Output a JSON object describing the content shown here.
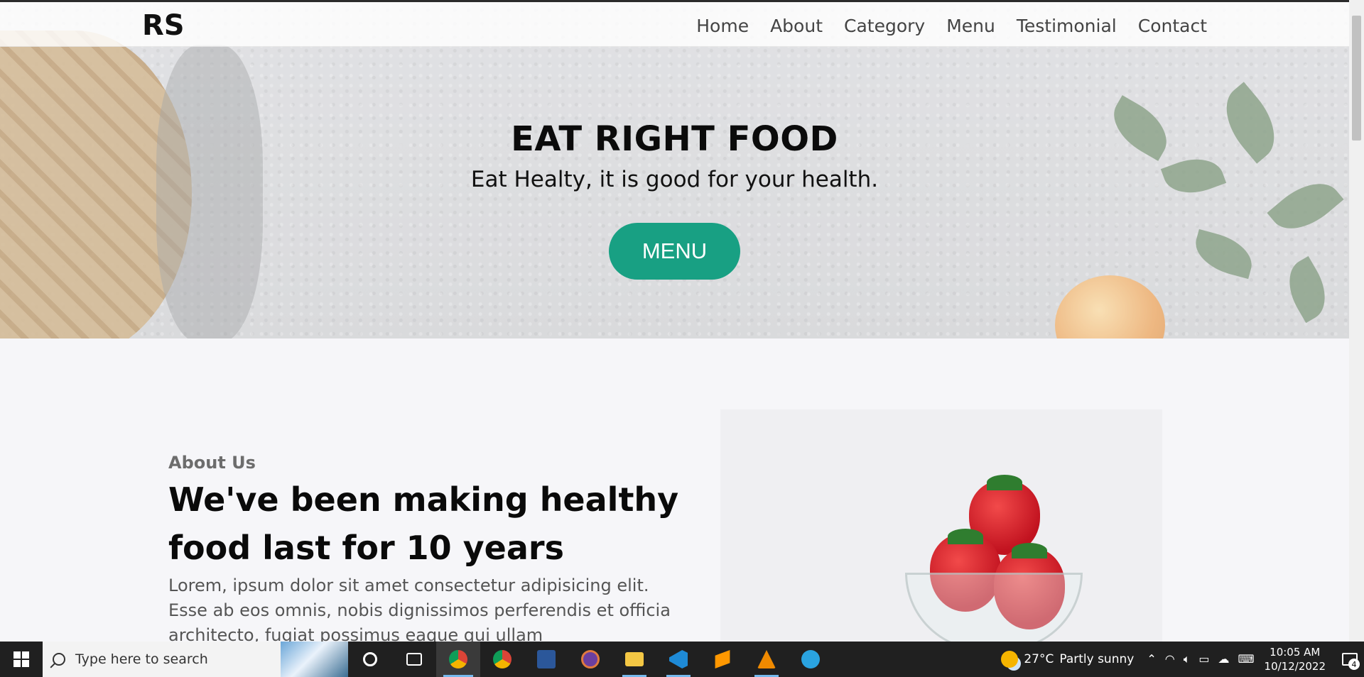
{
  "nav": {
    "logo": "RS",
    "items": [
      "Home",
      "About",
      "Category",
      "Menu",
      "Testimonial",
      "Contact"
    ]
  },
  "hero": {
    "title": "EAT RIGHT FOOD",
    "subtitle": "Eat Healty, it is good for your health.",
    "button": "MENU"
  },
  "about": {
    "label": "About Us",
    "title": "We've been making healthy food last for 10 years",
    "text": "Lorem, ipsum dolor sit amet consectetur adipisicing elit. Esse ab eos omnis, nobis dignissimos perferendis et officia architecto, fugiat possimus eaque qui ullam"
  },
  "colors": {
    "accent": "#18a083"
  },
  "taskbar": {
    "search_placeholder": "Type here to search",
    "weather_temp": "27°C",
    "weather_text": "Partly sunny",
    "time": "10:05 AM",
    "date": "10/12/2022",
    "notification_count": "4",
    "apps": [
      "cortana-icon",
      "task-view-icon",
      "chrome-icon",
      "chrome-icon",
      "word-icon",
      "media-player-icon",
      "file-explorer-icon",
      "vscode-icon",
      "sublime-icon",
      "vlc-icon",
      "telegram-icon"
    ]
  }
}
